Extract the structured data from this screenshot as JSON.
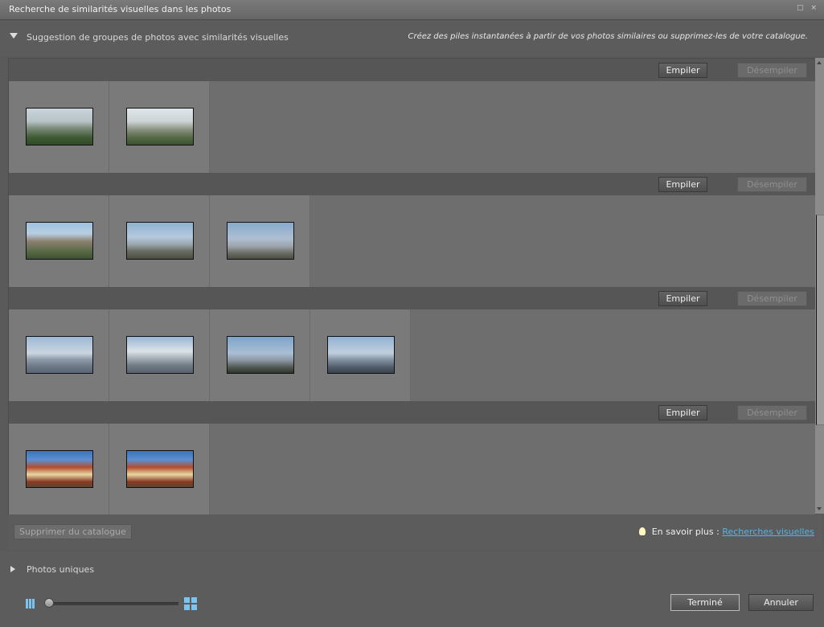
{
  "window": {
    "title": "Recherche de similarités visuelles dans les photos",
    "controls": "□ ×"
  },
  "suggestions": {
    "heading": "Suggestion de groupes de photos avec similarités visuelles",
    "description": "Créez des piles instantanées à partir de vos photos similaires ou supprimez-les de votre catalogue."
  },
  "group_buttons": {
    "stack_label": "Empiler",
    "unstack_label": "Désempiler"
  },
  "groups": [
    {
      "photos": [
        "mountain-village-1",
        "mountain-village-2"
      ]
    },
    {
      "photos": [
        "monastery-ruin",
        "valley-view-1",
        "valley-view-2"
      ]
    },
    {
      "photos": [
        "snow-peaks-1",
        "snow-peaks-2",
        "tree-silhouette-valley",
        "hills-haze"
      ]
    },
    {
      "photos": [
        "temple-facade-1",
        "temple-facade-2"
      ]
    }
  ],
  "footer": {
    "remove_label": "Supprimer du catalogue",
    "learn_more_prefix": "En savoir plus : ",
    "learn_more_link": "Recherches visuelles"
  },
  "unique_photos": {
    "label": "Photos uniques"
  },
  "actions": {
    "done_label": "Terminé",
    "cancel_label": "Annuler"
  },
  "thumbnail_zoom": 0.0,
  "colors": {
    "accent": "#7cc4ef",
    "link": "#4fb6e8",
    "panel": "#6e6e6e",
    "cell": "#7a7a7a"
  }
}
